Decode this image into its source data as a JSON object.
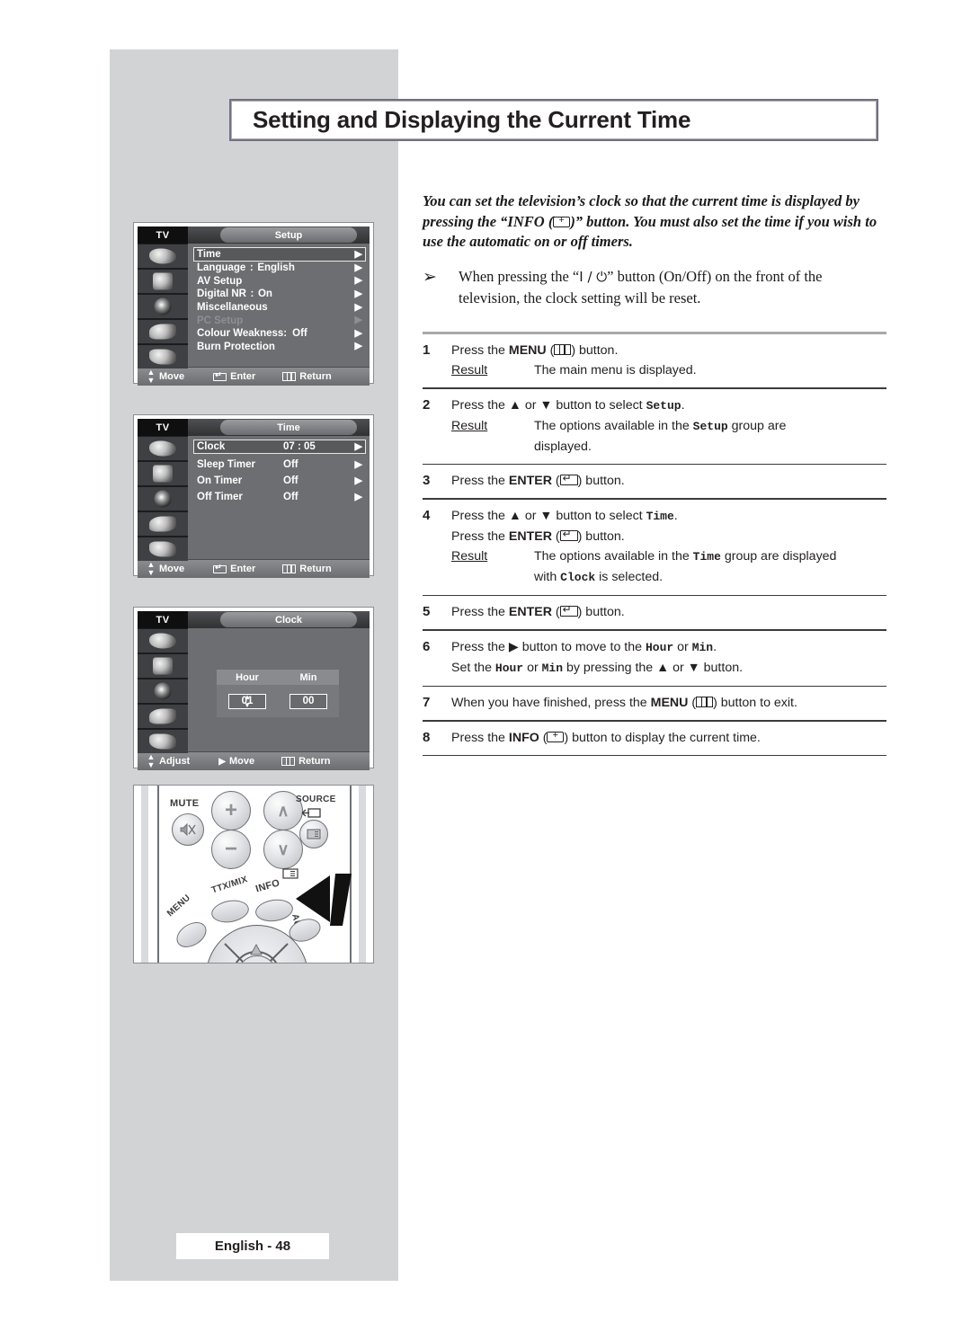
{
  "page": {
    "title": "Setting and Displaying the Current Time",
    "footer": "English - 48"
  },
  "intro": {
    "text": "You can set the television's clock so that the current time is displayed by pressing the “INFO (  )” button. You must also set the time if you wish to use the automatic on or off timers."
  },
  "note": {
    "bullet": "➢",
    "text_before": "When pressing the “",
    "power_symbol": "I / ⏻",
    "text_after": "” button (On/Off) on the front of the television, the clock setting will be reset."
  },
  "steps": [
    {
      "num": "1",
      "lines": [
        {
          "parts": [
            "Press the ",
            "MENU",
            " (",
            "menu-icon",
            ") button."
          ]
        }
      ],
      "result_label": "Result:",
      "result_text": "The main menu is displayed."
    },
    {
      "num": "2",
      "lines": [
        {
          "parts": [
            "Press the ▲ or ▼ button to select ",
            "Setup",
            "."
          ]
        }
      ],
      "result_label": "Result:",
      "result_text": "The options available in the Setup group are displayed."
    },
    {
      "num": "3",
      "lines": [
        {
          "parts": [
            "Press the ",
            "ENTER",
            " (",
            "enter-icon",
            ") button."
          ]
        }
      ],
      "result_label": "",
      "result_text": ""
    },
    {
      "num": "4",
      "lines": [
        {
          "parts": [
            "Press the ▲ or ▼ button to select ",
            "Time",
            "."
          ]
        },
        {
          "parts": [
            "Press the ",
            "ENTER",
            " (",
            "enter-icon",
            ") button."
          ]
        }
      ],
      "result_label": "Result:",
      "result_text": "The options available in the Time group are displayed with Clock is selected."
    },
    {
      "num": "5",
      "lines": [
        {
          "parts": [
            "Press the ",
            "ENTER",
            " (",
            "enter-icon",
            ") button."
          ]
        }
      ],
      "result_label": "",
      "result_text": ""
    },
    {
      "num": "6",
      "lines": [
        {
          "parts": [
            "Press the ▶ button to move to the ",
            "Hour",
            " or ",
            "Min",
            "."
          ]
        },
        {
          "parts": [
            "Set the ",
            "Hour",
            " or ",
            "Min",
            " by pressing the ▲ or ▼ button."
          ]
        }
      ],
      "result_label": "",
      "result_text": ""
    },
    {
      "num": "7",
      "lines": [
        {
          "parts": [
            "When you have finished, press the ",
            "MENU",
            " (",
            "menu-icon",
            ") button to exit."
          ]
        }
      ],
      "result_label": "",
      "result_text": ""
    },
    {
      "num": "8",
      "lines": [
        {
          "parts": [
            "Press the ",
            "INFO",
            " (",
            "info-icon",
            ") button to display the current time."
          ]
        }
      ],
      "result_label": "",
      "result_text": ""
    }
  ],
  "step_text": {
    "s1_a": "Press the ",
    "s1_menu": "MENU",
    "s1_b": ") button.",
    "s1_result_label": "Result",
    "s1_result_colon": ":",
    "s1_result": "The main menu is displayed.",
    "s2_a": "Press the ▲ or ▼ button to select ",
    "s2_code": "Setup",
    "s2_b": ".",
    "s2_result_label": "Result",
    "s2_result_colon": ":",
    "s2_result_a": "The options available in the ",
    "s2_result_code": "Setup",
    "s2_result_b": " group are",
    "s2_result_c": "displayed.",
    "s3_a": "Press the ",
    "s3_enter": "ENTER",
    "s3_b": ") button.",
    "s4_a": "Press the ▲ or ▼ button to select ",
    "s4_code": "Time",
    "s4_b": ".",
    "s4_c": "Press the ",
    "s4_enter": "ENTER",
    "s4_d": ") button.",
    "s4_result_label": "Result",
    "s4_result_colon": ":",
    "s4_result_a": "The options available in the ",
    "s4_result_code": "Time",
    "s4_result_b": " group are displayed",
    "s4_result_c": "with ",
    "s4_result_code2": "Clock",
    "s4_result_d": " is selected.",
    "s5_a": "Press the ",
    "s5_enter": "ENTER",
    "s5_b": ") button.",
    "s6_a": "Press the ▶ button to move to the ",
    "s6_code1": "Hour",
    "s6_b": " or ",
    "s6_code2": "Min",
    "s6_c": ".",
    "s6_d": "Set the ",
    "s6_code3": "Hour",
    "s6_e": " or ",
    "s6_code4": "Min",
    "s6_f": " by pressing the ▲ or ▼ button.",
    "s7_a": "When you have finished, press the ",
    "s7_menu": "MENU",
    "s7_b": ") button to exit.",
    "s8_a": "Press the ",
    "s8_info": "INFO",
    "s8_b": ") button to display the current time."
  },
  "osd_setup": {
    "device": "TV",
    "title": "Setup",
    "rows": [
      {
        "label": "Time",
        "sep": "",
        "value": "",
        "arrow": "▶",
        "selected": true,
        "dim": false
      },
      {
        "label": "Language",
        "sep": ":",
        "value": "English",
        "arrow": "▶",
        "selected": false,
        "dim": false
      },
      {
        "label": "AV Setup",
        "sep": "",
        "value": "",
        "arrow": "▶",
        "selected": false,
        "dim": false
      },
      {
        "label": "Digital NR",
        "sep": ":",
        "value": "On",
        "arrow": "▶",
        "selected": false,
        "dim": false
      },
      {
        "label": "Miscellaneous",
        "sep": "",
        "value": "",
        "arrow": "▶",
        "selected": false,
        "dim": false
      },
      {
        "label": "PC Setup",
        "sep": "",
        "value": "",
        "arrow": "▶",
        "selected": false,
        "dim": true
      },
      {
        "label": "Colour Weakness:",
        "sep": "",
        "value": "Off",
        "arrow": "▶",
        "selected": false,
        "dim": false
      },
      {
        "label": "Burn Protection",
        "sep": "",
        "value": "",
        "arrow": "▶",
        "selected": false,
        "dim": false
      }
    ],
    "footer": {
      "move": "Move",
      "enter": "Enter",
      "return": "Return"
    }
  },
  "osd_time": {
    "device": "TV",
    "title": "Time",
    "rows": [
      {
        "label": "Clock",
        "value": "07 : 05",
        "arrow": "▶",
        "selected": true
      },
      {
        "label": "Sleep Timer",
        "value": "Off",
        "arrow": "▶",
        "selected": false
      },
      {
        "label": "On Timer",
        "value": "Off",
        "arrow": "▶",
        "selected": false
      },
      {
        "label": "Off Timer",
        "value": "Off",
        "arrow": "▶",
        "selected": false
      }
    ],
    "footer": {
      "move": "Move",
      "enter": "Enter",
      "return": "Return"
    }
  },
  "osd_clock": {
    "device": "TV",
    "title": "Clock",
    "hour_label": "Hour",
    "min_label": "Min",
    "hour_value": "01",
    "min_value": "00",
    "footer": {
      "adjust": "Adjust",
      "move": "Move",
      "return": "Return"
    }
  },
  "remote": {
    "mute_label": "MUTE",
    "source_label": "SOURCE",
    "menu_label": "MENU",
    "ttx_label": "TTX/MIX",
    "info_label": "INFO",
    "auto_label": "AUTO",
    "plus": "+",
    "minus": "−"
  },
  "colors": {
    "panel_gray": "#d2d3d5",
    "title_border": "#6e7285",
    "osd_bg": "#6d6e71",
    "osd_rail": "#1c1c1e",
    "rule_thick": "#a7a9ac",
    "rule_thin": "#3b3b3b"
  }
}
